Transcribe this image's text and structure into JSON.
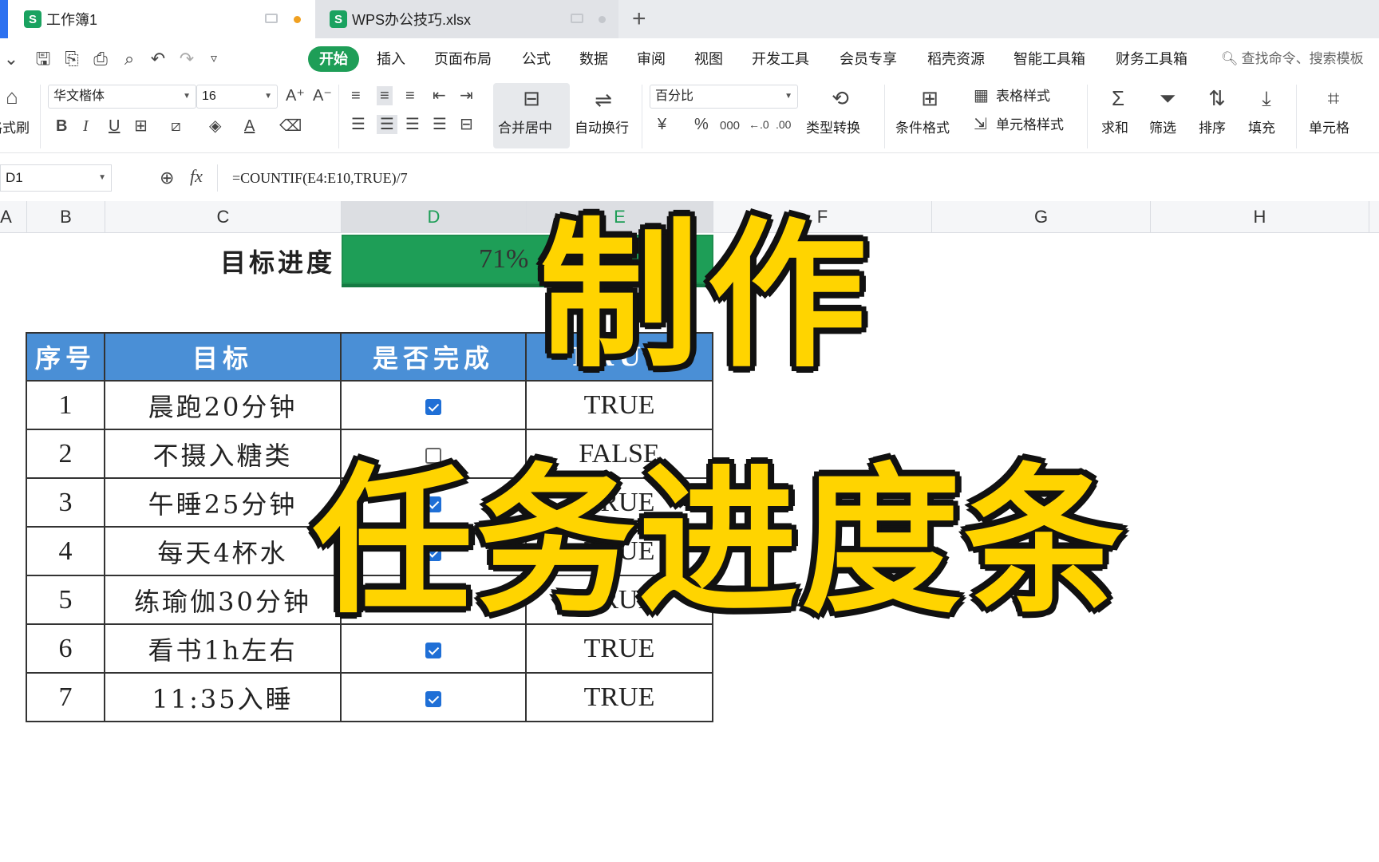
{
  "tabs": [
    {
      "label": "工作簿1",
      "active": true
    },
    {
      "label": "WPS办公技巧.xlsx",
      "active": false
    }
  ],
  "new_tab_symbol": "+",
  "quick_access": [
    "save-icon",
    "export-icon",
    "print-icon",
    "preview-icon",
    "undo-icon",
    "redo-icon",
    "more-icon"
  ],
  "menu": {
    "start": "开始",
    "items": [
      "插入",
      "页面布局",
      "公式",
      "数据",
      "审阅",
      "视图",
      "开发工具",
      "会员专享",
      "稻壳资源",
      "智能工具箱",
      "财务工具箱"
    ],
    "search_placeholder": "查找命令、搜索模板"
  },
  "ribbon": {
    "format_painter": "格式刷",
    "font_name": "华文楷体",
    "font_size": "16",
    "merge_center": "合并居中",
    "wrap_text": "自动换行",
    "number_format": "百分比",
    "currency": "¥",
    "percent": "%",
    "thousands": "000",
    "type_convert": "类型转换",
    "cond_format": "条件格式",
    "table_style": "表格样式",
    "cell_style": "单元格样式",
    "sum": "求和",
    "filter": "筛选",
    "sort": "排序",
    "fill": "填充",
    "cell": "单元格"
  },
  "formula_bar": {
    "name_box": "D1",
    "fx": "fx",
    "formula": "=COUNTIF(E4:E10,TRUE)/7"
  },
  "columns": [
    "A",
    "B",
    "C",
    "D",
    "E",
    "F",
    "G",
    "H"
  ],
  "sheet": {
    "progress_label": "目标进度",
    "progress_value": "71%",
    "progress_fraction": 0.71,
    "headers": [
      "序号",
      "目标",
      "是否完成",
      "TRUE"
    ],
    "rows": [
      {
        "num": "1",
        "goal": "晨跑20分钟",
        "checked": true,
        "status": "TRUE"
      },
      {
        "num": "2",
        "goal": "不摄入糖类",
        "checked": false,
        "status": "FALSE"
      },
      {
        "num": "3",
        "goal": "午睡25分钟",
        "checked": true,
        "status": "TRUE"
      },
      {
        "num": "4",
        "goal": "每天4杯水",
        "checked": true,
        "status": "TRUE"
      },
      {
        "num": "5",
        "goal": "练瑜伽30分钟",
        "checked": true,
        "status": "TRUE"
      },
      {
        "num": "6",
        "goal": "看书1h左右",
        "checked": true,
        "status": "TRUE"
      },
      {
        "num": "7",
        "goal": "11:35入睡",
        "checked": true,
        "status": "TRUE"
      }
    ]
  },
  "overlay": {
    "line1": "制作",
    "line2": "任务进度条"
  },
  "colors": {
    "accent_green": "#1e9e57",
    "header_blue": "#4a8fd6",
    "overlay_yellow": "#ffd400",
    "checkbox_blue": "#1f6fd6"
  }
}
